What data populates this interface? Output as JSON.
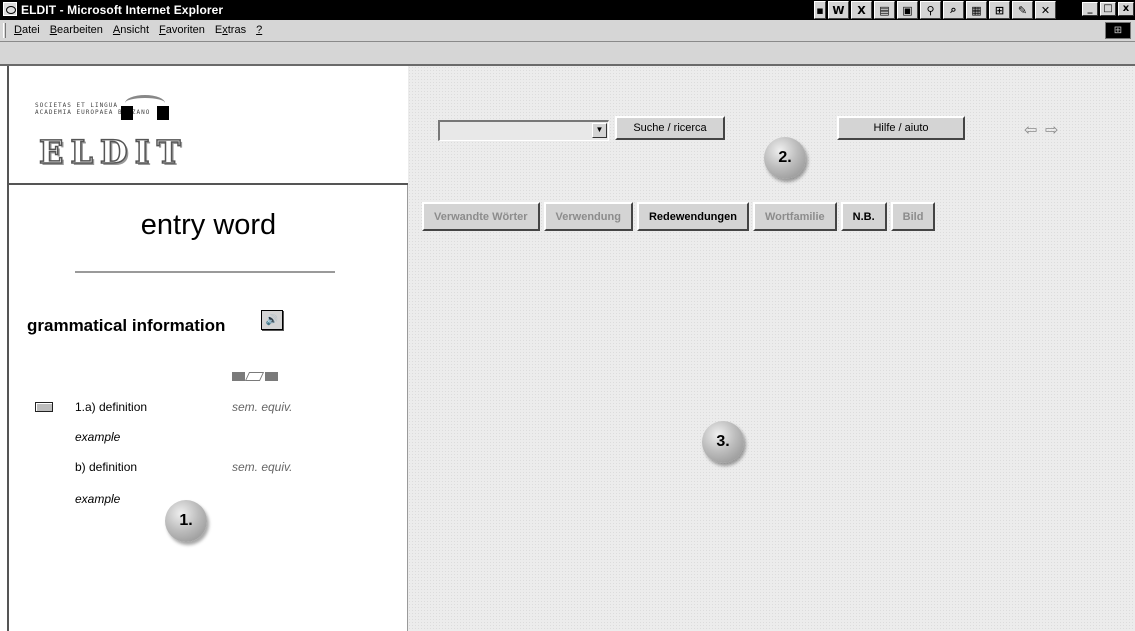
{
  "window": {
    "title": "ELDIT - Microsoft Internet Explorer",
    "controls": [
      "_",
      "□",
      "x"
    ]
  },
  "menu": {
    "items": [
      {
        "key": "D",
        "rest": "atei"
      },
      {
        "key": "B",
        "rest": "earbeiten"
      },
      {
        "key": "A",
        "rest": "nsicht"
      },
      {
        "key": "F",
        "rest": "avoriten"
      },
      {
        "pre": "E",
        "key": "x",
        "rest": "tras"
      },
      {
        "key": "?",
        "rest": ""
      }
    ]
  },
  "toolbar_icons": [
    "window-icon",
    "word-icon",
    "excel-icon",
    "note-icon",
    "image-icon",
    "magnifier-icon",
    "search-icon",
    "chart-icon",
    "translate-icon",
    "paint-icon",
    "tools-icon"
  ],
  "logo": {
    "small_text_line1": "SOCIETAS ET LINGUA",
    "small_text_line2": "ACADEMIA EUROPAEA BOLZANO",
    "main": "ELDIT"
  },
  "search": {
    "select_value": "",
    "search_label": "Suche / ricerca",
    "help_label": "Hilfe / aiuto"
  },
  "markers": {
    "one": "1.",
    "two": "2.",
    "three": "3."
  },
  "tabs": [
    {
      "label": "Verwandte Wörter",
      "active": false
    },
    {
      "label": "Verwendung",
      "active": false
    },
    {
      "label": "Redewendungen",
      "active": true
    },
    {
      "label": "Wortfamilie",
      "active": false
    },
    {
      "label": "N.B.",
      "active": true
    },
    {
      "label": "Bild",
      "active": false
    }
  ],
  "entry": {
    "word": "entry word",
    "grammatical_info": "grammatical information",
    "definitions": [
      {
        "text": "1.a) definition",
        "example": "example",
        "equiv": "sem. equiv."
      },
      {
        "text": "b) definition",
        "example": "example",
        "equiv": "sem. equiv."
      }
    ]
  }
}
